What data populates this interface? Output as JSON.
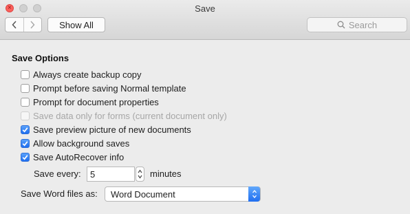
{
  "window": {
    "title": "Save"
  },
  "toolbar": {
    "back_icon": "chevron-left-icon",
    "forward_icon": "chevron-right-icon",
    "show_all_label": "Show All",
    "search_placeholder": "Search"
  },
  "section": {
    "title": "Save Options",
    "options": [
      {
        "label": "Always create backup copy",
        "checked": false,
        "disabled": false
      },
      {
        "label": "Prompt before saving Normal template",
        "checked": false,
        "disabled": false
      },
      {
        "label": "Prompt for document properties",
        "checked": false,
        "disabled": false
      },
      {
        "label": "Save data only for forms (current document only)",
        "checked": false,
        "disabled": true
      },
      {
        "label": "Save preview picture of new documents",
        "checked": true,
        "disabled": false
      },
      {
        "label": "Allow background saves",
        "checked": true,
        "disabled": false
      },
      {
        "label": "Save AutoRecover info",
        "checked": true,
        "disabled": false
      }
    ]
  },
  "autorecover": {
    "save_every_label": "Save every:",
    "value": "5",
    "unit_label": "minutes"
  },
  "save_as": {
    "label": "Save Word files as:",
    "selected": "Word Document"
  },
  "colors": {
    "accent": "#1e6ef0",
    "close_button": "#fc605c"
  }
}
